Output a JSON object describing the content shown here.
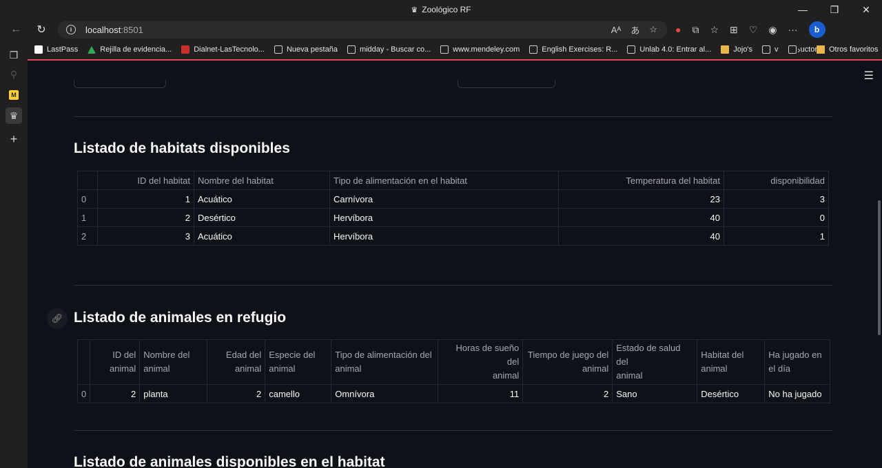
{
  "window": {
    "title": "Zoológico RF"
  },
  "address_bar": {
    "host": "localhost",
    "port": ":8501"
  },
  "bookmarks": [
    {
      "label": "LastPass",
      "icon": "lastpass-icon"
    },
    {
      "label": "Rejilla de evidencia...",
      "icon": "google-drive-icon"
    },
    {
      "label": "Dialnet-LasTecnolo...",
      "icon": "pdf-icon"
    },
    {
      "label": "Nueva pestaña",
      "icon": "page-icon"
    },
    {
      "label": "midday - Buscar co...",
      "icon": "page-icon"
    },
    {
      "label": "www.mendeley.com",
      "icon": "page-icon"
    },
    {
      "label": "English Exercises: R...",
      "icon": "page-icon"
    },
    {
      "label": "Unlab 4.0: Entrar al...",
      "icon": "page-icon"
    },
    {
      "label": "Jojo's",
      "icon": "folder-icon"
    },
    {
      "label": "v",
      "icon": "page-icon"
    },
    {
      "label": "uctor d",
      "icon": "page-icon"
    }
  ],
  "other_favorites": "Otros favoritos",
  "section_habitats": {
    "title": "Listado de habitats disponibles",
    "columns": [
      "ID del habitat",
      "Nombre del habitat",
      "Tipo de alimentación en el habitat",
      "Temperatura del habitat",
      "disponibilidad"
    ],
    "rows": [
      {
        "index": "0",
        "id": "1",
        "nombre": "Acuático",
        "tipo": "Carnívora",
        "temp": "23",
        "disp": "3"
      },
      {
        "index": "1",
        "id": "2",
        "nombre": "Desértico",
        "tipo": "Hervíbora",
        "temp": "40",
        "disp": "0"
      },
      {
        "index": "2",
        "id": "3",
        "nombre": "Acuático",
        "tipo": "Hervíbora",
        "temp": "40",
        "disp": "1"
      }
    ]
  },
  "section_animales": {
    "title": "Listado de animales en refugio",
    "columns": [
      [
        "ID del",
        "animal"
      ],
      [
        "Nombre del",
        "animal"
      ],
      [
        "Edad del",
        "animal"
      ],
      [
        "Especie del",
        "animal"
      ],
      [
        "Tipo de alimentación del",
        "animal"
      ],
      [
        "Horas de sueño del",
        "animal"
      ],
      [
        "Tiempo de juego del",
        "animal"
      ],
      [
        "Estado de salud del",
        "animal"
      ],
      [
        "Habitat del",
        "animal"
      ],
      [
        "Ha jugado en",
        "el día"
      ]
    ],
    "rows": [
      {
        "index": "0",
        "id": "2",
        "nombre": "planta",
        "edad": "2",
        "especie": "camello",
        "tipo": "Omnívora",
        "horas": "11",
        "juego": "2",
        "salud": "Sano",
        "habitat": "Desértico",
        "jugado": "No ha jugado"
      }
    ]
  },
  "section_disponibles": {
    "title": "Listado de animales disponibles en el habitat"
  },
  "colors": {
    "background": "#0e1117",
    "accent": "#e0455a",
    "text": "#fafafa",
    "muted": "#a3a8b4"
  }
}
